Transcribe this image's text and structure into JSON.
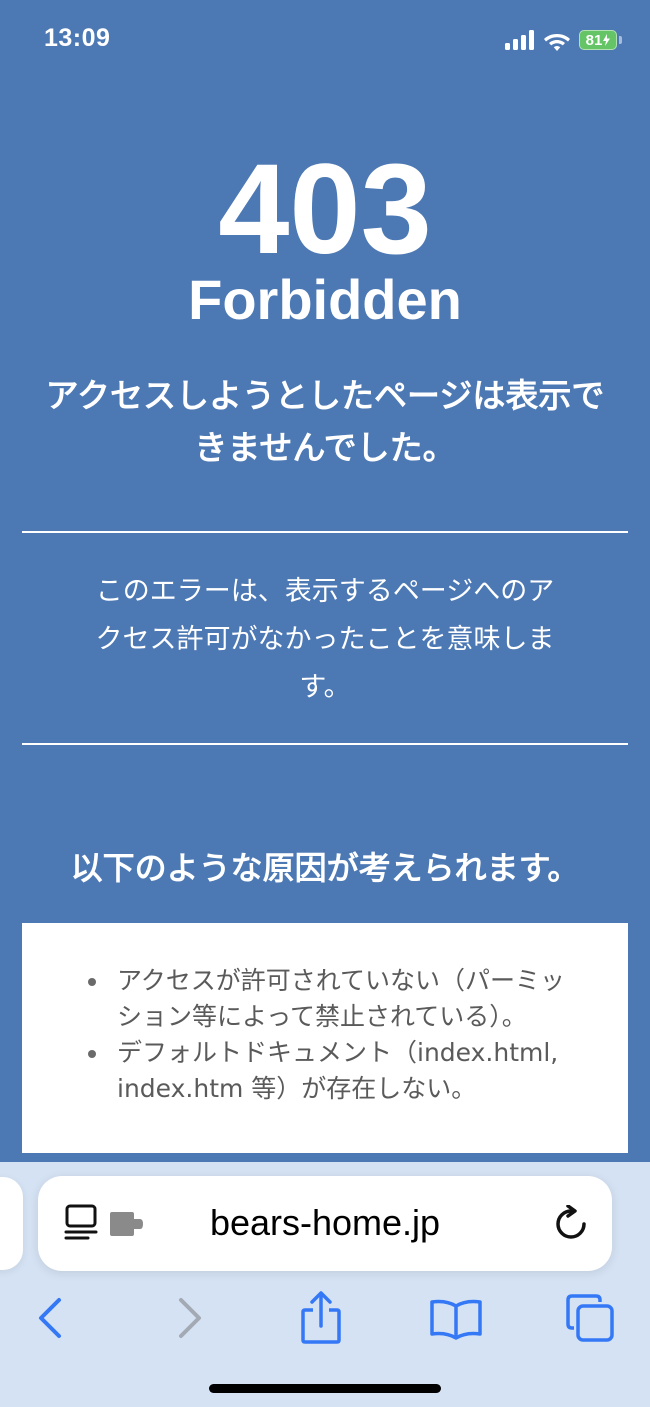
{
  "status_bar": {
    "time": "13:09",
    "battery_level": "81",
    "icons": [
      "cellular-signal-icon",
      "wifi-icon",
      "battery-charging-icon"
    ]
  },
  "error_page": {
    "code": "403",
    "name": "Forbidden",
    "title_line1": "アクセスしようとしたページは表示で",
    "title_line2": "きませんでした。",
    "description_line1": "このエラーは、表示するページへのア",
    "description_line2": "クセス許可がなかったことを意味しま",
    "description_line3": "す。",
    "causes_heading": "以下のような原因が考えられます。",
    "causes": [
      {
        "line1": "アクセスが許可されていない（パーミッ",
        "line2": "ション等によって禁止されている）。"
      },
      {
        "line1": "デフォルトドキュメント（index.html,",
        "line2": "index.htm 等）が存在しない。"
      }
    ]
  },
  "browser": {
    "url": "bears-home.jp",
    "icons": [
      "page-format-icon",
      "extension-icon",
      "reload-icon",
      "back-icon",
      "forward-icon",
      "share-icon",
      "bookmarks-icon",
      "tabs-icon"
    ]
  },
  "colors": {
    "page_background": "#4c78b4",
    "toolbar_background": "#d4e2f4",
    "accent": "#3478f6",
    "battery": "#65c466"
  }
}
